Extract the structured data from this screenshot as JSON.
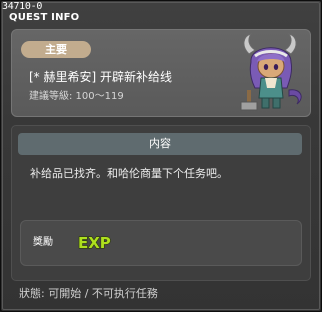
{
  "window": {
    "quest_id": "34710-0",
    "title": "QUEST INFO"
  },
  "info": {
    "category": "主要",
    "quest_name": "[* 赫里希安] 开辟新补给线",
    "level_label": "建議等級",
    "level_value": "100～119",
    "level_text": "建議等級: 100～119",
    "npc_portrait_icon": "npc-portrait-icon"
  },
  "content": {
    "header": "内容",
    "text": "补给品已找齐。和哈伦商量下个任务吧。"
  },
  "reward": {
    "label": "獎勵",
    "exp_icon": "exp-icon",
    "exp_text": "EXP"
  },
  "status": {
    "label": "狀態",
    "text": "狀態: 可開始 / 不可执行任務"
  },
  "colors": {
    "window_bg": "#3a3a3a",
    "info_panel_bg": "#606060",
    "category_tag": "#c2ac8e",
    "content_header_bg": "#5f6b6f",
    "exp_green": "#aee01e",
    "exp_outline": "#2c3a0a"
  }
}
